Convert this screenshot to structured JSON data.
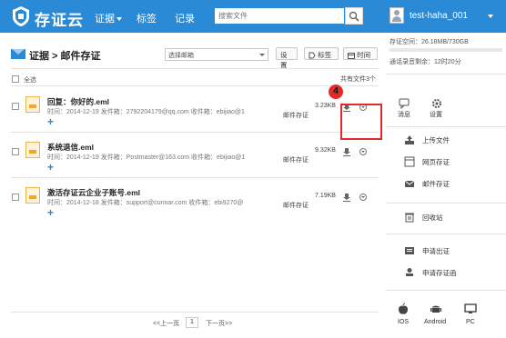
{
  "header": {
    "app_name": "存证云",
    "nav": [
      "证据",
      "标签",
      "记录"
    ],
    "search_placeholder": "搜索文件",
    "username": "test-haha_001"
  },
  "page": {
    "title": "证据 > 邮件存证",
    "mailbox_select": "选择邮箱",
    "btn_settings": "设置",
    "btn_tag": "标签",
    "btn_time": "时间",
    "select_all": "全选",
    "total": "共有文件3个"
  },
  "files": [
    {
      "name": "回复：你好的.eml",
      "meta": "时间：2014-12-19  发件箱：2792204179@qq.com  收件箱：ebijiao@1",
      "tag": "邮件存证",
      "size": "3.23KB"
    },
    {
      "name": "系统退信.eml",
      "meta": "时间：2014-12-19  发件箱：Postmaster@163.com  收件箱：ebijiao@1",
      "tag": "邮件存证",
      "size": "9.32KB"
    },
    {
      "name": "激活存证云企业子账号.eml",
      "meta": "时间：2014-12-18  发件箱：support@cunnar.com  收件箱：ebi9270@",
      "tag": "邮件存证",
      "size": "7.19KB"
    }
  ],
  "annotation": {
    "number": "4"
  },
  "pagination": {
    "prev": "<<上一页",
    "current": "1",
    "next": "下一页>>"
  },
  "sidebar": {
    "storage": "存证空间：26.18MB/730GB",
    "notary_time": "通话录音剩余：12时20分",
    "top_buttons": [
      "消息",
      "设置"
    ],
    "items": [
      "上传文件",
      "网页存证",
      "邮件存证",
      "回收站",
      "申请出证",
      "申请存证函"
    ],
    "devices": [
      "IOS",
      "Android",
      "PC"
    ]
  },
  "colors": {
    "brand": "#2b8ad6",
    "highlight": "#e02b2b"
  }
}
